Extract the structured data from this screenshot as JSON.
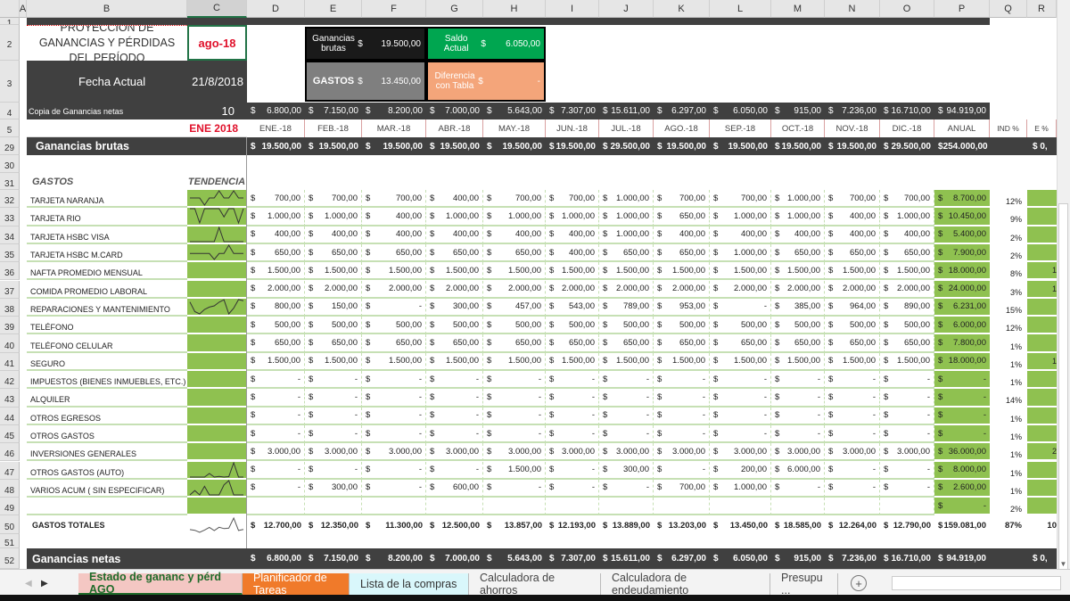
{
  "columns": [
    "A",
    "B",
    "C",
    "D",
    "E",
    "F",
    "G",
    "H",
    "I",
    "J",
    "K",
    "L",
    "M",
    "N",
    "O",
    "P",
    "Q",
    "R"
  ],
  "row_numbers": [
    "1",
    "2",
    "3",
    "4",
    "5",
    "29",
    "30",
    "31",
    "32",
    "33",
    "34",
    "35",
    "36",
    "37",
    "38",
    "39",
    "40",
    "41",
    "42",
    "43",
    "44",
    "45",
    "46",
    "47",
    "48",
    "49",
    "50",
    "51",
    "52"
  ],
  "title": "PROYECCIÓN DE GANANCIAS Y PÉRDIDAS DEL PERÍODO",
  "period": "ago-18",
  "fecha_label": "Fecha Actual",
  "fecha_value": "21/8/2018",
  "summary": {
    "ganancias_label": "Ganancias brutas",
    "ganancias_value": "19.500,00",
    "gastos_label": "GASTOS",
    "gastos_value": "13.450,00",
    "saldo_label": "Saldo Actual",
    "saldo_value": "6.050,00",
    "diferencia_label": "Diferencia con Tabla",
    "diferencia_value": "-",
    "currency": "$"
  },
  "copia": {
    "label": "Copia de Ganancias netas",
    "value": "10",
    "values": [
      "6.800,00",
      "7.150,00",
      "8.200,00",
      "7.000,00",
      "5.643,00",
      "7.307,00",
      "15.611,00",
      "6.297,00",
      "6.050,00",
      "915,00",
      "7.236,00",
      "16.710,00",
      "94.919,00"
    ]
  },
  "start_label": "ENE  2018",
  "months": [
    "ENE.-18",
    "FEB.-18",
    "MAR.-18",
    "ABR.-18",
    "MAY.-18",
    "JUN.-18",
    "JUL.-18",
    "AGO.-18",
    "SEP.-18",
    "OCT.-18",
    "NOV.-18",
    "DIC.-18"
  ],
  "anual_label": "ANUAL",
  "ind_label": "IND %",
  "e_label": "E %",
  "ganancias_brutas": {
    "label": "Ganancias brutas",
    "values": [
      "19.500,00",
      "19.500,00",
      "19.500,00",
      "19.500,00",
      "19.500,00",
      "19.500,00",
      "29.500,00",
      "19.500,00",
      "19.500,00",
      "19.500,00",
      "19.500,00",
      "29.500,00",
      "254.000,00"
    ],
    "e": "$ 0,"
  },
  "gastos_label": "GASTOS",
  "tendencia_label": "TENDENCIA",
  "expenses": [
    {
      "label": "TARJETA NARANJA",
      "values": [
        "700,00",
        "700,00",
        "700,00",
        "400,00",
        "700,00",
        "700,00",
        "1.000,00",
        "700,00",
        "700,00",
        "1.000,00",
        "700,00",
        "700,00"
      ],
      "anual": "8.700,00",
      "ind": "12%",
      "e": ""
    },
    {
      "label": "TARJETA RIO",
      "values": [
        "1.000,00",
        "1.000,00",
        "400,00",
        "1.000,00",
        "1.000,00",
        "1.000,00",
        "1.000,00",
        "650,00",
        "1.000,00",
        "1.000,00",
        "400,00",
        "1.000,00"
      ],
      "anual": "10.450,00",
      "ind": "9%",
      "e": ""
    },
    {
      "label": "TARJETA HSBC VISA",
      "values": [
        "400,00",
        "400,00",
        "400,00",
        "400,00",
        "400,00",
        "400,00",
        "1.000,00",
        "400,00",
        "400,00",
        "400,00",
        "400,00",
        "400,00"
      ],
      "anual": "5.400,00",
      "ind": "2%",
      "e": ""
    },
    {
      "label": "TARJETA HSBC M.CARD",
      "values": [
        "650,00",
        "650,00",
        "650,00",
        "650,00",
        "650,00",
        "400,00",
        "650,00",
        "650,00",
        "1.000,00",
        "650,00",
        "650,00",
        "650,00"
      ],
      "anual": "7.900,00",
      "ind": "2%",
      "e": ""
    },
    {
      "label": "NAFTA PROMEDIO MENSUAL",
      "values": [
        "1.500,00",
        "1.500,00",
        "1.500,00",
        "1.500,00",
        "1.500,00",
        "1.500,00",
        "1.500,00",
        "1.500,00",
        "1.500,00",
        "1.500,00",
        "1.500,00",
        "1.500,00"
      ],
      "anual": "18.000,00",
      "ind": "8%",
      "e": "1"
    },
    {
      "label": "COMIDA PROMEDIO LABORAL",
      "values": [
        "2.000,00",
        "2.000,00",
        "2.000,00",
        "2.000,00",
        "2.000,00",
        "2.000,00",
        "2.000,00",
        "2.000,00",
        "2.000,00",
        "2.000,00",
        "2.000,00",
        "2.000,00"
      ],
      "anual": "24.000,00",
      "ind": "3%",
      "e": "1"
    },
    {
      "label": "REPARACIONES Y MANTENIMIENTO",
      "values": [
        "800,00",
        "150,00",
        "-",
        "300,00",
        "457,00",
        "543,00",
        "789,00",
        "953,00",
        "-",
        "385,00",
        "964,00",
        "890,00"
      ],
      "anual": "6.231,00",
      "ind": "15%",
      "e": ""
    },
    {
      "label": "TELÉFONO",
      "values": [
        "500,00",
        "500,00",
        "500,00",
        "500,00",
        "500,00",
        "500,00",
        "500,00",
        "500,00",
        "500,00",
        "500,00",
        "500,00",
        "500,00"
      ],
      "anual": "6.000,00",
      "ind": "12%",
      "e": ""
    },
    {
      "label": "TELÉFONO CELULAR",
      "values": [
        "650,00",
        "650,00",
        "650,00",
        "650,00",
        "650,00",
        "650,00",
        "650,00",
        "650,00",
        "650,00",
        "650,00",
        "650,00",
        "650,00"
      ],
      "anual": "7.800,00",
      "ind": "1%",
      "e": ""
    },
    {
      "label": "SEGURO",
      "values": [
        "1.500,00",
        "1.500,00",
        "1.500,00",
        "1.500,00",
        "1.500,00",
        "1.500,00",
        "1.500,00",
        "1.500,00",
        "1.500,00",
        "1.500,00",
        "1.500,00",
        "1.500,00"
      ],
      "anual": "18.000,00",
      "ind": "1%",
      "e": "1"
    },
    {
      "label": "IMPUESTOS (BIENES INMUEBLES, ETC.)",
      "values": [
        "-",
        "-",
        "-",
        "-",
        "-",
        "-",
        "-",
        "-",
        "-",
        "-",
        "-",
        "-"
      ],
      "anual": "-",
      "ind": "1%",
      "e": ""
    },
    {
      "label": "ALQUILER",
      "values": [
        "-",
        "-",
        "-",
        "-",
        "-",
        "-",
        "-",
        "-",
        "-",
        "-",
        "-",
        "-"
      ],
      "anual": "-",
      "ind": "14%",
      "e": ""
    },
    {
      "label": "OTROS EGRESOS",
      "values": [
        "-",
        "-",
        "-",
        "-",
        "-",
        "-",
        "-",
        "-",
        "-",
        "-",
        "-",
        "-"
      ],
      "anual": "-",
      "ind": "1%",
      "e": ""
    },
    {
      "label": "OTROS GASTOS",
      "values": [
        "-",
        "-",
        "-",
        "-",
        "-",
        "-",
        "-",
        "-",
        "-",
        "-",
        "-",
        "-"
      ],
      "anual": "-",
      "ind": "1%",
      "e": ""
    },
    {
      "label": "INVERSIONES GENERALES",
      "values": [
        "3.000,00",
        "3.000,00",
        "3.000,00",
        "3.000,00",
        "3.000,00",
        "3.000,00",
        "3.000,00",
        "3.000,00",
        "3.000,00",
        "3.000,00",
        "3.000,00",
        "3.000,00"
      ],
      "anual": "36.000,00",
      "ind": "1%",
      "e": "2"
    },
    {
      "label": "OTROS GASTOS (AUTO)",
      "values": [
        "-",
        "-",
        "-",
        "-",
        "1.500,00",
        "-",
        "300,00",
        "-",
        "200,00",
        "6.000,00",
        "-",
        "-"
      ],
      "anual": "8.000,00",
      "ind": "1%",
      "e": ""
    },
    {
      "label": "VARIOS ACUM ( SIN ESPECIFICAR)",
      "values": [
        "-",
        "300,00",
        "-",
        "600,00",
        "-",
        "-",
        "-",
        "700,00",
        "1.000,00",
        "-",
        "-",
        "-"
      ],
      "anual": "2.600,00",
      "ind": "1%",
      "e": ""
    },
    {
      "label": "",
      "values": [
        "",
        "",
        "",
        "",
        "",
        "",
        "",
        "",
        "",
        "",
        "",
        ""
      ],
      "anual": "-",
      "ind": "2%",
      "e": ""
    }
  ],
  "totales": {
    "label": "GASTOS TOTALES",
    "values": [
      "12.700,00",
      "12.350,00",
      "11.300,00",
      "12.500,00",
      "13.857,00",
      "12.193,00",
      "13.889,00",
      "13.203,00",
      "13.450,00",
      "18.585,00",
      "12.264,00",
      "12.790,00",
      "159.081,00"
    ],
    "ind": "87%",
    "e": "10"
  },
  "ganancias_netas": {
    "label": "Ganancias netas",
    "values": [
      "6.800,00",
      "7.150,00",
      "8.200,00",
      "7.000,00",
      "5.643,00",
      "7.307,00",
      "15.611,00",
      "6.297,00",
      "6.050,00",
      "915,00",
      "7.236,00",
      "16.710,00",
      "94.919,00"
    ],
    "e": "$ 0,"
  },
  "sheet_tabs": [
    {
      "label": "Estado de gananc y pérd AGO",
      "bg": "#f4c7c3",
      "color": "#1f6b2a",
      "active": true
    },
    {
      "label": "Planificador de Tareas",
      "bg": "#f07a2a",
      "color": "#fff"
    },
    {
      "label": "Lista de la compras",
      "bg": "#d9f7fb",
      "color": "#333"
    },
    {
      "label": "Calculadora de ahorros",
      "bg": "",
      "color": "#444"
    },
    {
      "label": "Calculadora de endeudamiento",
      "bg": "",
      "color": "#444"
    },
    {
      "label": "Presupu ...",
      "bg": "",
      "color": "#444"
    }
  ],
  "colors": {
    "dark": "#404040",
    "green": "#8fc150",
    "saldo": "#00a650",
    "diferencia": "#f4a57a",
    "gastos_box": "#7f7f7f",
    "ganancias_box": "#1a1a1a",
    "accent_red": "#e0102a"
  }
}
